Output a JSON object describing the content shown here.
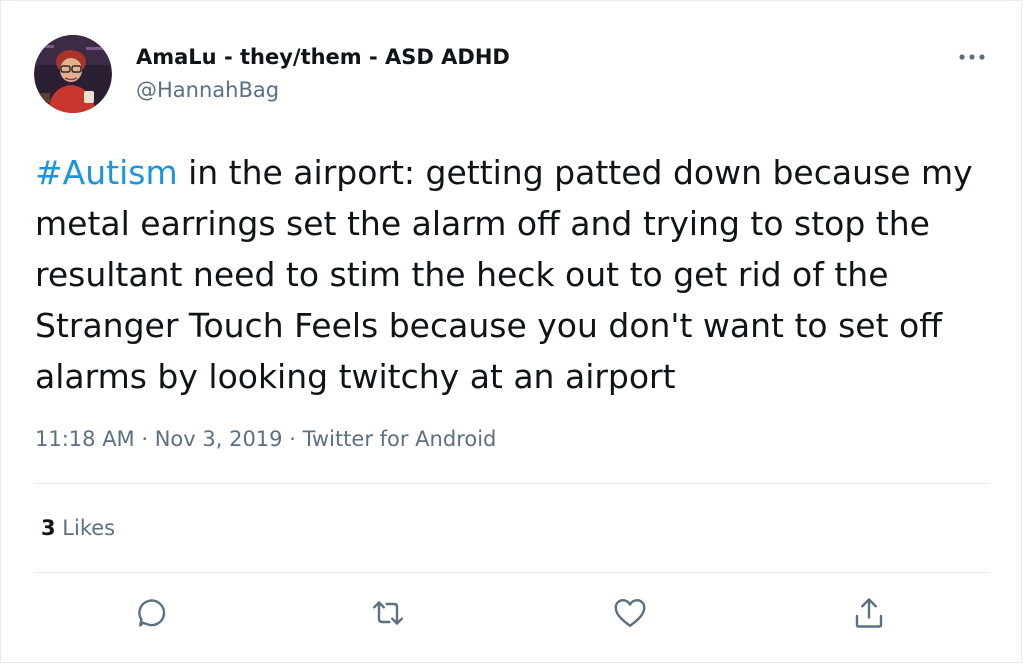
{
  "author": {
    "display_name": "AmaLu - they/them - ASD ADHD",
    "handle": "@HannahBag"
  },
  "tweet": {
    "hashtag": "#Autism",
    "text": " in the airport: getting patted down because my metal earrings set the alarm off and trying to stop the resultant need to stim the heck out to get rid of the Stranger Touch Feels because you don't want to set off alarms by looking twitchy at an airport"
  },
  "meta": {
    "time": "11:18 AM",
    "separator": " · ",
    "date": "Nov 3, 2019",
    "source": "Twitter for Android"
  },
  "engagement": {
    "likes_count": "3",
    "likes_label": " Likes"
  },
  "icons": {
    "more": "more-dots-icon",
    "reply": "reply-icon",
    "retweet": "retweet-icon",
    "like": "heart-icon",
    "share": "share-icon"
  },
  "colors": {
    "link": "#1b95e0",
    "secondary_text": "#5b7083",
    "primary_text": "#0f1419",
    "divider": "#e6ecf0"
  }
}
